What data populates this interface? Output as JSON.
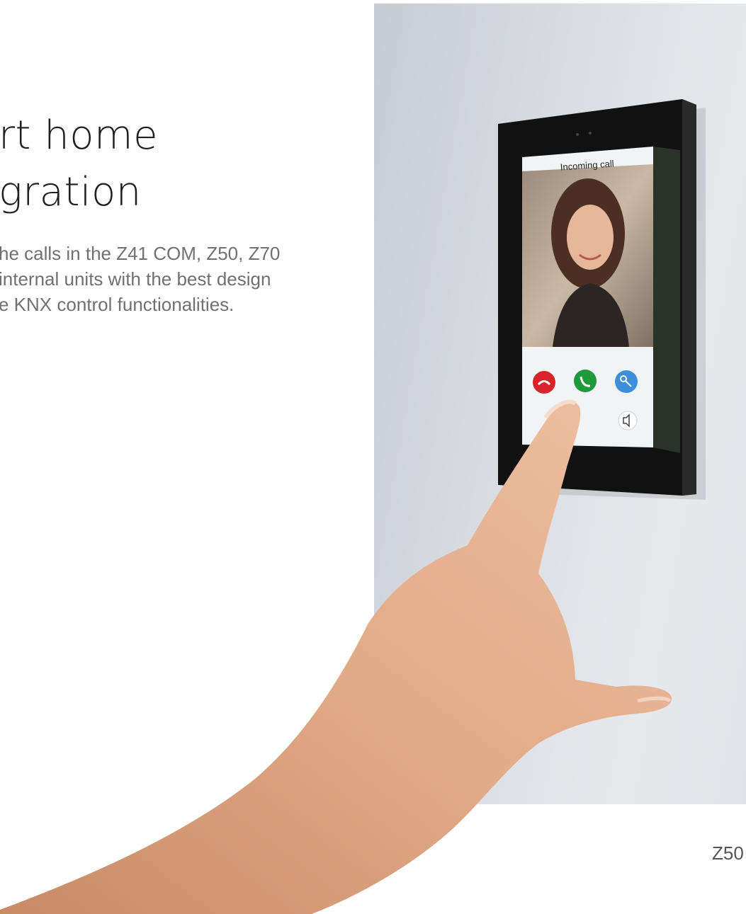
{
  "headline": {
    "line1": "rt home",
    "line2": "gration"
  },
  "description": {
    "line1": "he calls in the Z41 COM, Z50, Z70",
    "line2": "internal units with the best design",
    "line3": "e KNX control functionalities."
  },
  "device": {
    "screen_title": "Incoming call",
    "buttons": {
      "reject_icon": "hang-up-icon",
      "accept_icon": "phone-icon",
      "door_icon": "key-icon",
      "speaker_icon": "speaker-icon"
    },
    "colors": {
      "reject": "#d8242a",
      "accept": "#1f9a3a",
      "door": "#3c8fd8",
      "bezel": "#111111"
    }
  },
  "caption": "Z50"
}
